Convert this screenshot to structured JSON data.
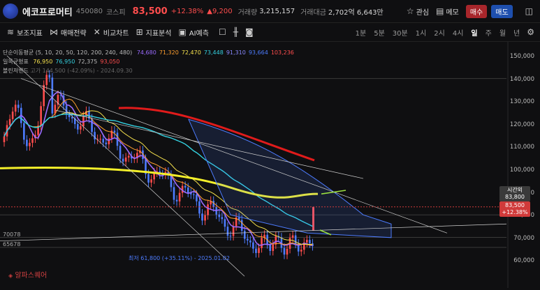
{
  "header": {
    "stock_name": "에코프로머티",
    "code": "450080",
    "market": "코스피",
    "price": "83,500",
    "change_pct": "+12.38%",
    "change_amt": "▲9,200",
    "volume_label": "거래량",
    "volume": "3,215,157",
    "amount_label": "거래대금",
    "amount": "2,702억 6,643만",
    "watch_label": "관심",
    "memo_label": "메모",
    "buy_label": "매수",
    "sell_label": "매도"
  },
  "toolbar": {
    "indicator_label": "보조지표",
    "strategy_label": "매매전략",
    "compare_label": "비교차트",
    "analysis_label": "지표분석",
    "ai_label": "AI예측",
    "periods": [
      "1분",
      "5분",
      "30분",
      "1시",
      "2시",
      "4시",
      "일",
      "주",
      "월",
      "년"
    ],
    "active_period": "일"
  },
  "legend": {
    "ma_label": "단순이동평균 (5, 10, 20, 50, 120, 200, 240, 480)",
    "ma_values": [
      "74,680",
      "71,320",
      "72,470",
      "73,448",
      "91,310",
      "93,664",
      "103,236"
    ],
    "ichimoku_label": "일목균형표",
    "ichimoku_values": [
      "76,950",
      "76,950",
      "72,375",
      "93,050"
    ],
    "bollinger_label": "볼린저밴드",
    "bollinger_overlap": "고가 144,500 (-42.09%) - 2024.09.30"
  },
  "chart_labels": {
    "line1": "70078",
    "line2": "65678",
    "low_note": "최저 61,800 (+35.11%) - 2025.01.02",
    "brand": "알파스퀘어",
    "tag_time": "시간외",
    "tag_time_val": "83,800",
    "tag_price": "83,500",
    "tag_pct": "+12.38%"
  },
  "price_axis": [
    "150,000",
    "140,000",
    "130,000",
    "120,000",
    "110,000",
    "100,000",
    "90,000",
    "80,000",
    "70,000",
    "60,000"
  ],
  "colors": {
    "up": "#ff4d4d",
    "down": "#4d7cff",
    "buy": "#a8262b",
    "sell": "#1e4fae"
  }
}
